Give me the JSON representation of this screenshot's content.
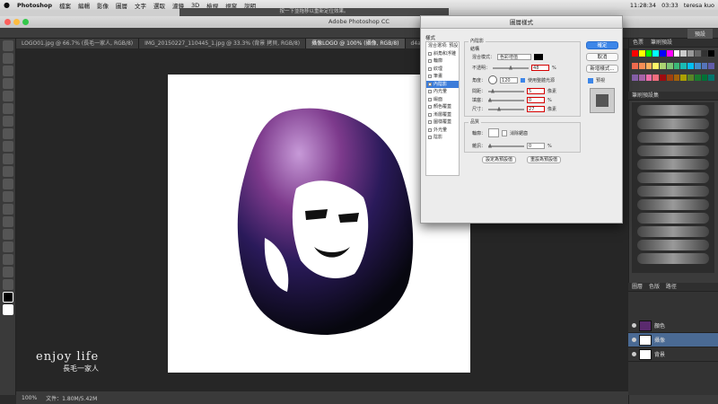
{
  "menubar": {
    "apple": "",
    "app": "Photoshop",
    "items": [
      "檔案",
      "編輯",
      "影像",
      "圖層",
      "文字",
      "選取",
      "濾鏡",
      "3D",
      "檢視",
      "視窗",
      "說明"
    ],
    "time": "11:28:34",
    "clock2": "03:33",
    "user": "teresa kuo"
  },
  "titlebar": {
    "title": "Adobe Photoshop CC"
  },
  "hint_bar": {
    "text": "按一下並拖移以重新定位效果。"
  },
  "optionsbar": {
    "right_label": "預設"
  },
  "doc_tabs": [
    {
      "label": "LOGO01.jpg @ 66.7% (長毛一家人, RGB/8)"
    },
    {
      "label": "IMG_20150227_110445_1.jpg @ 33.3% (背景 拷貝, RGB/8)"
    },
    {
      "label": "攝像LOGO @ 100% (攝像, RGB/8)",
      "active": true
    },
    {
      "label": "d4a871f2f7f1a17eec0a9..."
    }
  ],
  "watermark": {
    "line1": "enjoy life",
    "line2": "長毛一家人"
  },
  "statusbar": {
    "zoom": "100%",
    "doc": "文件：1.80M/5.42M"
  },
  "right_panels": {
    "swatches_tabs": [
      "色票",
      "筆刷預設"
    ],
    "brush_tabs": [
      "筆刷預設集"
    ],
    "layers_tabs": [
      "圖層",
      "色版",
      "路徑"
    ],
    "layers": [
      {
        "name": "顏色",
        "selected": false
      },
      {
        "name": "攝像",
        "selected": true
      },
      {
        "name": "背景",
        "selected": false
      }
    ]
  },
  "dialog": {
    "title": "圖層樣式",
    "styles_header": "樣式",
    "styles": [
      {
        "label": "混合選項: 預設",
        "checkbox": false
      },
      {
        "label": "斜角和浮雕",
        "checkbox": true
      },
      {
        "label": "輪廓",
        "checkbox": true
      },
      {
        "label": "紋理",
        "checkbox": true
      },
      {
        "label": "筆畫",
        "checkbox": true
      },
      {
        "label": "內陰影",
        "checkbox": true,
        "selected": true
      },
      {
        "label": "內光暈",
        "checkbox": true
      },
      {
        "label": "緞面",
        "checkbox": true
      },
      {
        "label": "顏色覆蓋",
        "checkbox": true
      },
      {
        "label": "漸層覆蓋",
        "checkbox": true
      },
      {
        "label": "圖樣覆蓋",
        "checkbox": true
      },
      {
        "label": "外光暈",
        "checkbox": true
      },
      {
        "label": "陰影",
        "checkbox": true
      }
    ],
    "group1_title": "內陰影",
    "structure_title": "結構",
    "blend_mode_label": "混合模式：",
    "blend_mode_value": "色彩增值",
    "opacity_label": "不透明：",
    "opacity_value": "48",
    "opacity_unit": "%",
    "angle_label": "角度：",
    "angle_value": "120",
    "global_light_label": "使用整體光源",
    "distance_label": "間距：",
    "distance_value": "5",
    "choke_label": "填塞：",
    "choke_value": "0",
    "size_label": "尺寸：",
    "size_value": "27",
    "px_unit": "像素",
    "quality_title": "品質",
    "contour_label": "輪廓：",
    "antialias_label": "消除鋸齒",
    "noise_label": "雜訊：",
    "noise_value": "0",
    "make_default": "設定為預設值",
    "reset_default": "重設為預設值",
    "ok": "確定",
    "cancel": "取消",
    "new_style": "新增樣式...",
    "preview": "預視"
  },
  "colors": {
    "accent": "#3d86e8",
    "highlight": "#d40000",
    "selected_layer": "#4a6a94"
  }
}
